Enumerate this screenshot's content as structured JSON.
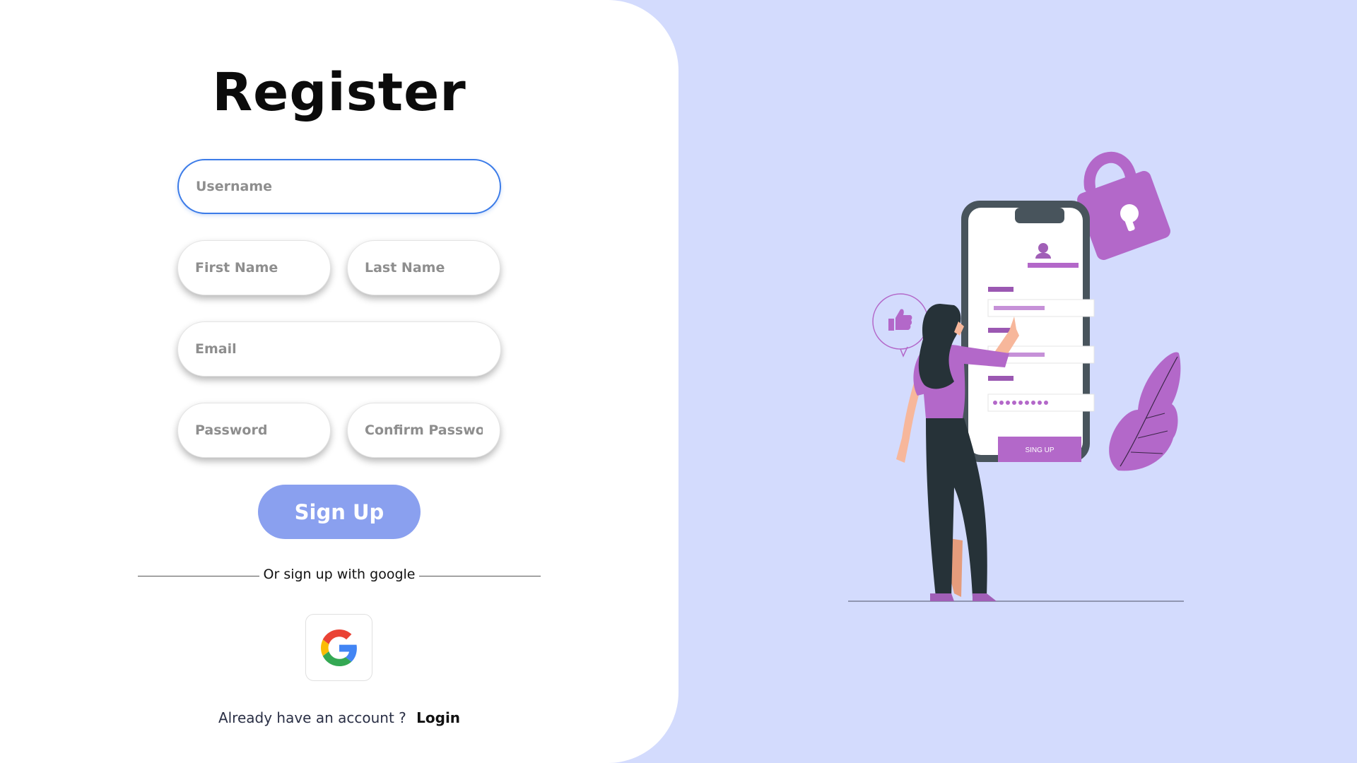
{
  "form": {
    "title": "Register",
    "username_placeholder": "Username",
    "first_name_placeholder": "First Name",
    "last_name_placeholder": "Last Name",
    "email_placeholder": "Email",
    "password_placeholder": "Password",
    "confirm_password_placeholder": "Confirm Password",
    "signup_label": "Sign Up",
    "divider_text": "Or sign up with google",
    "google_icon": "google-logo-icon",
    "account_prompt": "Already have an account ?",
    "login_label": "Login"
  },
  "illustration": {
    "phone_button_text": "SING UP"
  },
  "colors": {
    "background": "#d3dbfd",
    "panel": "#ffffff",
    "signup_button": "#8aa0ef",
    "accent_purple": "#b368c9",
    "focus_border": "#3b7be8"
  }
}
